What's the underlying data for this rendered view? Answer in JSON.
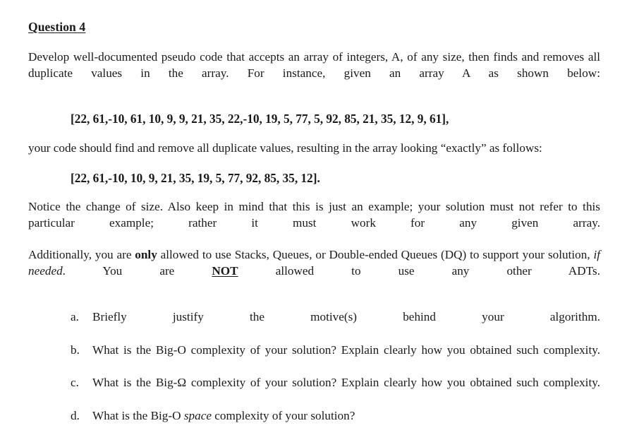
{
  "document": {
    "title": "Question 4",
    "paragraphs": {
      "intro": {
        "text": "Develop well-documented pseudo code that accepts an array of integers, A, of any size, then finds and removes all duplicate values in the array. For instance, given an array A as shown below:"
      },
      "array_input": {
        "text": "[22, 61,-10, 61, 10, 9, 9, 21, 35, 22,-10, 19, 5, 77, 5, 92, 85, 21, 35, 12, 9, 61],"
      },
      "instruction": {
        "text": "your code should find and remove all duplicate values, resulting in the array looking “exactly” as follows:"
      },
      "array_output": {
        "text": "[22, 61,-10, 10, 9, 21, 35, 19, 5, 77, 92, 85, 35, 12]."
      },
      "notice": {
        "text": "Notice the change of size. Also keep in mind that this is just an example; your solution must not refer to this particular example; rather it must work for any given array."
      },
      "restriction": {
        "part1": "Additionally, you are ",
        "emphasis_only": "only",
        "part2": " allowed to use Stacks, Queues, or Double-ended Queues (DQ) to support your solution, ",
        "emphasis_if_needed": "if needed",
        "part3": ". You are ",
        "emphasis_not": "NOT",
        "part4": " allowed to use any other ADTs."
      }
    },
    "questions": [
      {
        "marker": "a.",
        "text": "Briefly justify the motive(s) behind your algorithm."
      },
      {
        "marker": "b.",
        "text": "What is the Big-O complexity of your solution? Explain clearly how you obtained such complexity."
      },
      {
        "marker": "c.",
        "text": "What is the Big-Ω complexity of your solution? Explain clearly how you obtained such complexity."
      },
      {
        "marker": "d.",
        "prefix": "What is the Big-O ",
        "emphasis": "space",
        "suffix": " complexity of your solution?"
      }
    ]
  },
  "colors": {
    "page_background": "#ffffff",
    "text": "#1a1a1a"
  }
}
